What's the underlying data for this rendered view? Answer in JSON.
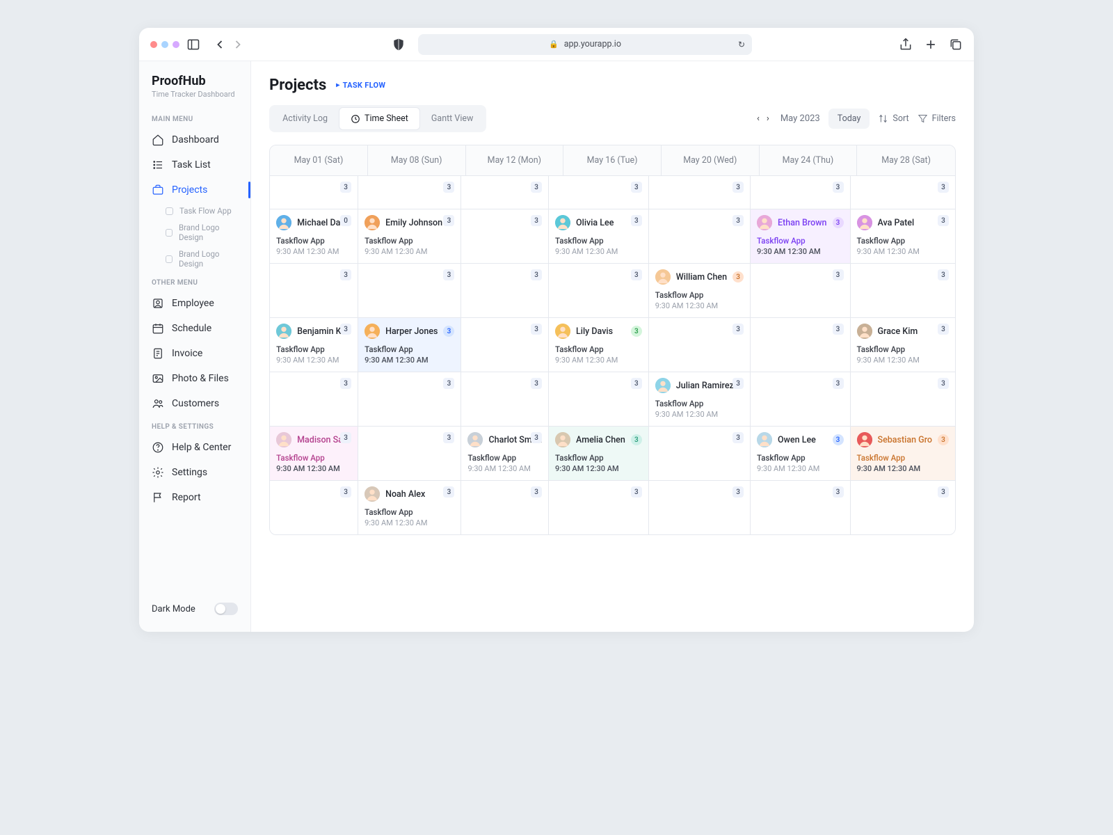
{
  "browser": {
    "url": "app.yourapp.io"
  },
  "brand": {
    "name": "ProofHub",
    "subtitle": "Time Tracker Dashboard"
  },
  "sidebar": {
    "sec_main": "MAIN MENU",
    "sec_other": "OTHER MENU",
    "sec_help": "HELP & SETTINGS",
    "items": {
      "dashboard": "Dashboard",
      "tasklist": "Task List",
      "projects": "Projects",
      "employee": "Employee",
      "schedule": "Schedule",
      "invoice": "Invoice",
      "photofiles": "Photo & Files",
      "customers": "Customers",
      "helpcenter": "Help & Center",
      "settings": "Settings",
      "report": "Report"
    },
    "subs": [
      "Task Flow App",
      "Brand Logo Design",
      "Brand Logo Design"
    ],
    "darkmode": "Dark Mode"
  },
  "page": {
    "title": "Projects",
    "crumb": "TASK FLOW"
  },
  "tabs": {
    "activity": "Activity Log",
    "timesheet": "Time Sheet",
    "gantt": "Gantt View"
  },
  "controls": {
    "month": "May 2023",
    "today": "Today",
    "sort": "Sort",
    "filters": "Filters"
  },
  "cols": [
    "May 01 (Sat)",
    "May 08 (Sun)",
    "May 12 (Mon)",
    "May 16 (Tue)",
    "May 20 (Wed)",
    "May 24 (Thu)",
    "May 28 (Sat)"
  ],
  "task_default": {
    "title": "Taskflow App",
    "time": "9:30 AM 12:30 AM"
  },
  "rows": [
    [
      {
        "b": "3"
      },
      {
        "b": "3"
      },
      {
        "b": "3"
      },
      {
        "b": "3"
      },
      {
        "b": "3"
      },
      {
        "b": "3"
      },
      {
        "b": "3"
      }
    ],
    [
      {
        "b": "0",
        "name": "Michael Davis",
        "av": [
          "#5fb0e8",
          "#2d7fc4"
        ],
        "task": true
      },
      {
        "b": "3",
        "name": "Emily Johnson",
        "av": [
          "#f0a05a",
          "#d67a2e"
        ],
        "task": true
      },
      {
        "b": "3"
      },
      {
        "b": "3",
        "name": "Olivia Lee",
        "av": [
          "#5bc8d8",
          "#2896ab"
        ],
        "task": true
      },
      {
        "b": "3"
      },
      {
        "b": "3",
        "name": "Ethan Brown",
        "av": [
          "#e8a8d8",
          "#c878b8"
        ],
        "pbg": "#e9d9ff",
        "pfg": "#7b3ff2",
        "hl": "purple",
        "task": true
      },
      {
        "b": "3",
        "name": "Ava Patel",
        "av": [
          "#d893e2",
          "#b05fc2"
        ],
        "task": true
      }
    ],
    [
      {
        "b": "3"
      },
      {
        "b": "3"
      },
      {
        "b": "3"
      },
      {
        "b": "3"
      },
      {
        "b": "3",
        "name": "William Chen",
        "av": [
          "#f5c896",
          "#e8a05a"
        ],
        "pbg": "#ffe0cc",
        "pfg": "#c9732c",
        "task": true
      },
      {
        "b": "3"
      },
      {
        "b": "3"
      }
    ],
    [
      {
        "b": "3",
        "name": "Benjamin Kim",
        "av": [
          "#6ec8d8",
          "#3a9cb0"
        ],
        "task": true
      },
      {
        "b": "3",
        "name": "Harper Jones",
        "av": [
          "#f5b05a",
          "#e88a2a"
        ],
        "pbg": "#d4e4ff",
        "pfg": "#2562ff",
        "hl": "blue",
        "task": true
      },
      {
        "b": "3"
      },
      {
        "b": "3",
        "name": "Lily Davis",
        "av": [
          "#f5c05a",
          "#e89a2a"
        ],
        "pbg": "#d4f5dc",
        "pfg": "#2a9d4a",
        "task": true
      },
      {
        "b": "3"
      },
      {
        "b": "3"
      },
      {
        "b": "3",
        "name": "Grace Kim",
        "av": [
          "#c8b096",
          "#a8906a"
        ],
        "task": true
      }
    ],
    [
      {
        "b": "3"
      },
      {
        "b": "3"
      },
      {
        "b": "3"
      },
      {
        "b": "3"
      },
      {
        "b": "3",
        "name": "Julian Ramirez",
        "av": [
          "#8ed4e8",
          "#5ab0d0"
        ],
        "task": true
      },
      {
        "b": "3"
      },
      {
        "b": "3"
      }
    ],
    [
      {
        "b": "3",
        "name": "Madison San",
        "av": [
          "#e8c8d8",
          "#d098b8"
        ],
        "hl": "pink",
        "task": true
      },
      {
        "b": "3"
      },
      {
        "b": "3",
        "name": "Charlot Smith",
        "av": [
          "#c8d0d8",
          "#98a8b8"
        ],
        "task": true
      },
      {
        "b": "3",
        "name": "Amelia Chen",
        "av": [
          "#d8c8b0",
          "#b8a080"
        ],
        "pbg": "#cef0e8",
        "pfg": "#2a9d7a",
        "hl": "teal",
        "task": true
      },
      {
        "b": "3"
      },
      {
        "b": "3",
        "name": "Owen Lee",
        "av": [
          "#b8d8e8",
          "#88b8d0"
        ],
        "pbg": "#d4e4ff",
        "pfg": "#2562ff",
        "task": true
      },
      {
        "b": "3",
        "name": "Sebastian Gro",
        "av": [
          "#e85a5a",
          "#c83838"
        ],
        "pbg": "#ffe0cc",
        "pfg": "#c9732c",
        "hl": "orange",
        "task": true
      }
    ],
    [
      {
        "b": "3"
      },
      {
        "b": "3",
        "name": "Noah Alex",
        "av": [
          "#d8c8b8",
          "#b8a088"
        ],
        "task": true
      },
      {
        "b": "3"
      },
      {
        "b": "3"
      },
      {
        "b": "3"
      },
      {
        "b": "3"
      },
      {
        "b": "3"
      }
    ]
  ]
}
